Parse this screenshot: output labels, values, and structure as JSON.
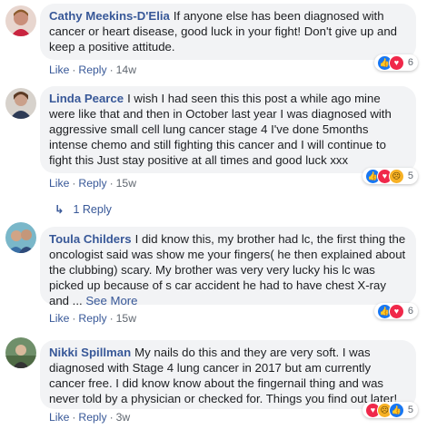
{
  "comments": [
    {
      "author": "Cathy Meekins-D'Elia",
      "text": "If anyone else has been diagnosed with cancer or heart disease, good luck in your fight! Don't give up and keep a positive attitude.",
      "like": "Like",
      "reply": "Reply",
      "time": "14w",
      "reaction_count": "6",
      "reactions": [
        "like",
        "love"
      ]
    },
    {
      "author": "Linda Pearce",
      "text": "I wish I had seen this this post a while ago mine were like that and then in October last year I was diagnosed with aggressive small cell lung cancer stage 4 I've done 5months intense chemo and still fighting this cancer and I will continue to fight this Just stay positive at all times and good luck xxx",
      "like": "Like",
      "reply": "Reply",
      "time": "15w",
      "reaction_count": "5",
      "reactions": [
        "like",
        "love",
        "sad"
      ]
    },
    {
      "author": "Toula Childers",
      "text": "I did know this, my brother had lc, the first thing the oncologist said was show me your fingers( he then explained about the clubbing) scary. My brother was very very lucky his lc was picked up because of s car accident he had to have chest X-ray and ...",
      "see_more": "See More",
      "like": "Like",
      "reply": "Reply",
      "time": "15w",
      "reaction_count": "6",
      "reactions": [
        "like",
        "love"
      ]
    },
    {
      "author": "Nikki Spillman",
      "text": "My nails do this and they are very soft. I was diagnosed with Stage 4 lung cancer in 2017 but am currently cancer free. I did know know about the fingernail thing and was never told by a physician or checked for. Things you find out later!",
      "like": "Like",
      "reply": "Reply",
      "time": "3w",
      "reaction_count": "5",
      "reactions": [
        "love",
        "sad",
        "like"
      ]
    }
  ],
  "replies_link": "1 Reply",
  "separator": "·",
  "colors": {
    "link": "#385898",
    "bubble": "#f2f3f5",
    "like": "#1877f2",
    "love": "#f0284a",
    "sad": "#f7b125"
  }
}
